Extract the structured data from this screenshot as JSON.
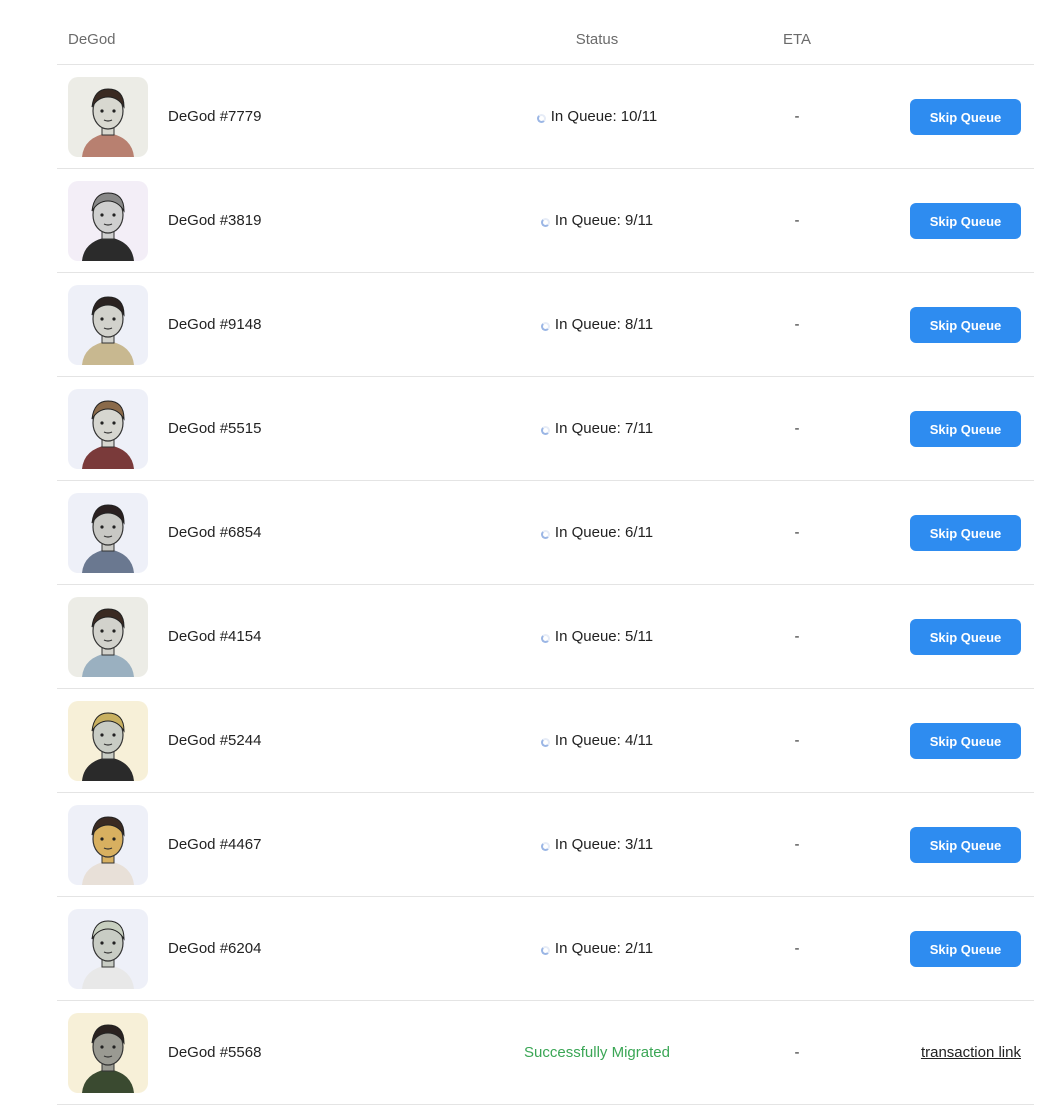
{
  "header": {
    "degod": "DeGod",
    "status": "Status",
    "eta": "ETA"
  },
  "rows": [
    {
      "name": "DeGod #7779",
      "status": "In Queue: 10/11",
      "eta": "-",
      "action": "Skip Queue",
      "bg": "#ecece6",
      "hair": "#3a2a22",
      "skin": "#d8d8d0",
      "shirt": "#b88070"
    },
    {
      "name": "DeGod #3819",
      "status": "In Queue: 9/11",
      "eta": "-",
      "action": "Skip Queue",
      "bg": "#f3eef7",
      "hair": "#888888",
      "skin": "#cfcfcf",
      "shirt": "#2b2b2b"
    },
    {
      "name": "DeGod #9148",
      "status": "In Queue: 8/11",
      "eta": "-",
      "action": "Skip Queue",
      "bg": "#eef0f8",
      "hair": "#2a2220",
      "skin": "#d2d2cc",
      "shirt": "#c8b890"
    },
    {
      "name": "DeGod #5515",
      "status": "In Queue: 7/11",
      "eta": "-",
      "action": "Skip Queue",
      "bg": "#eef0f8",
      "hair": "#8a6a4a",
      "skin": "#d6d6d0",
      "shirt": "#7a3a3a"
    },
    {
      "name": "DeGod #6854",
      "status": "In Queue: 6/11",
      "eta": "-",
      "action": "Skip Queue",
      "bg": "#eef0f8",
      "hair": "#2a2020",
      "skin": "#c8c8c4",
      "shirt": "#6a7890"
    },
    {
      "name": "DeGod #4154",
      "status": "In Queue: 5/11",
      "eta": "-",
      "action": "Skip Queue",
      "bg": "#ecece6",
      "hair": "#3a2a22",
      "skin": "#d2d2cc",
      "shirt": "#9ab0c0"
    },
    {
      "name": "DeGod #5244",
      "status": "In Queue: 4/11",
      "eta": "-",
      "action": "Skip Queue",
      "bg": "#f7f0d8",
      "hair": "#c8b060",
      "skin": "#c8ccc4",
      "shirt": "#2a2a2a"
    },
    {
      "name": "DeGod #4467",
      "status": "In Queue: 3/11",
      "eta": "-",
      "action": "Skip Queue",
      "bg": "#eef0f8",
      "hair": "#3a2a22",
      "skin": "#d8b060",
      "shirt": "#e8e0d8"
    },
    {
      "name": "DeGod #6204",
      "status": "In Queue: 2/11",
      "eta": "-",
      "action": "Skip Queue",
      "bg": "#eef0f8",
      "hair": "#c8d0c0",
      "skin": "#c8ccc4",
      "shirt": "#e8e8e8"
    },
    {
      "name": "DeGod #5568",
      "status": "Successfully Migrated",
      "eta": "-",
      "action": "transaction link",
      "bg": "#f7f0d8",
      "hair": "#2a2220",
      "skin": "#9a9a92",
      "shirt": "#3a4a30"
    }
  ],
  "colors": {
    "button": "#2e8cf0",
    "success": "#3aa655",
    "divider": "#e4e4e4"
  }
}
